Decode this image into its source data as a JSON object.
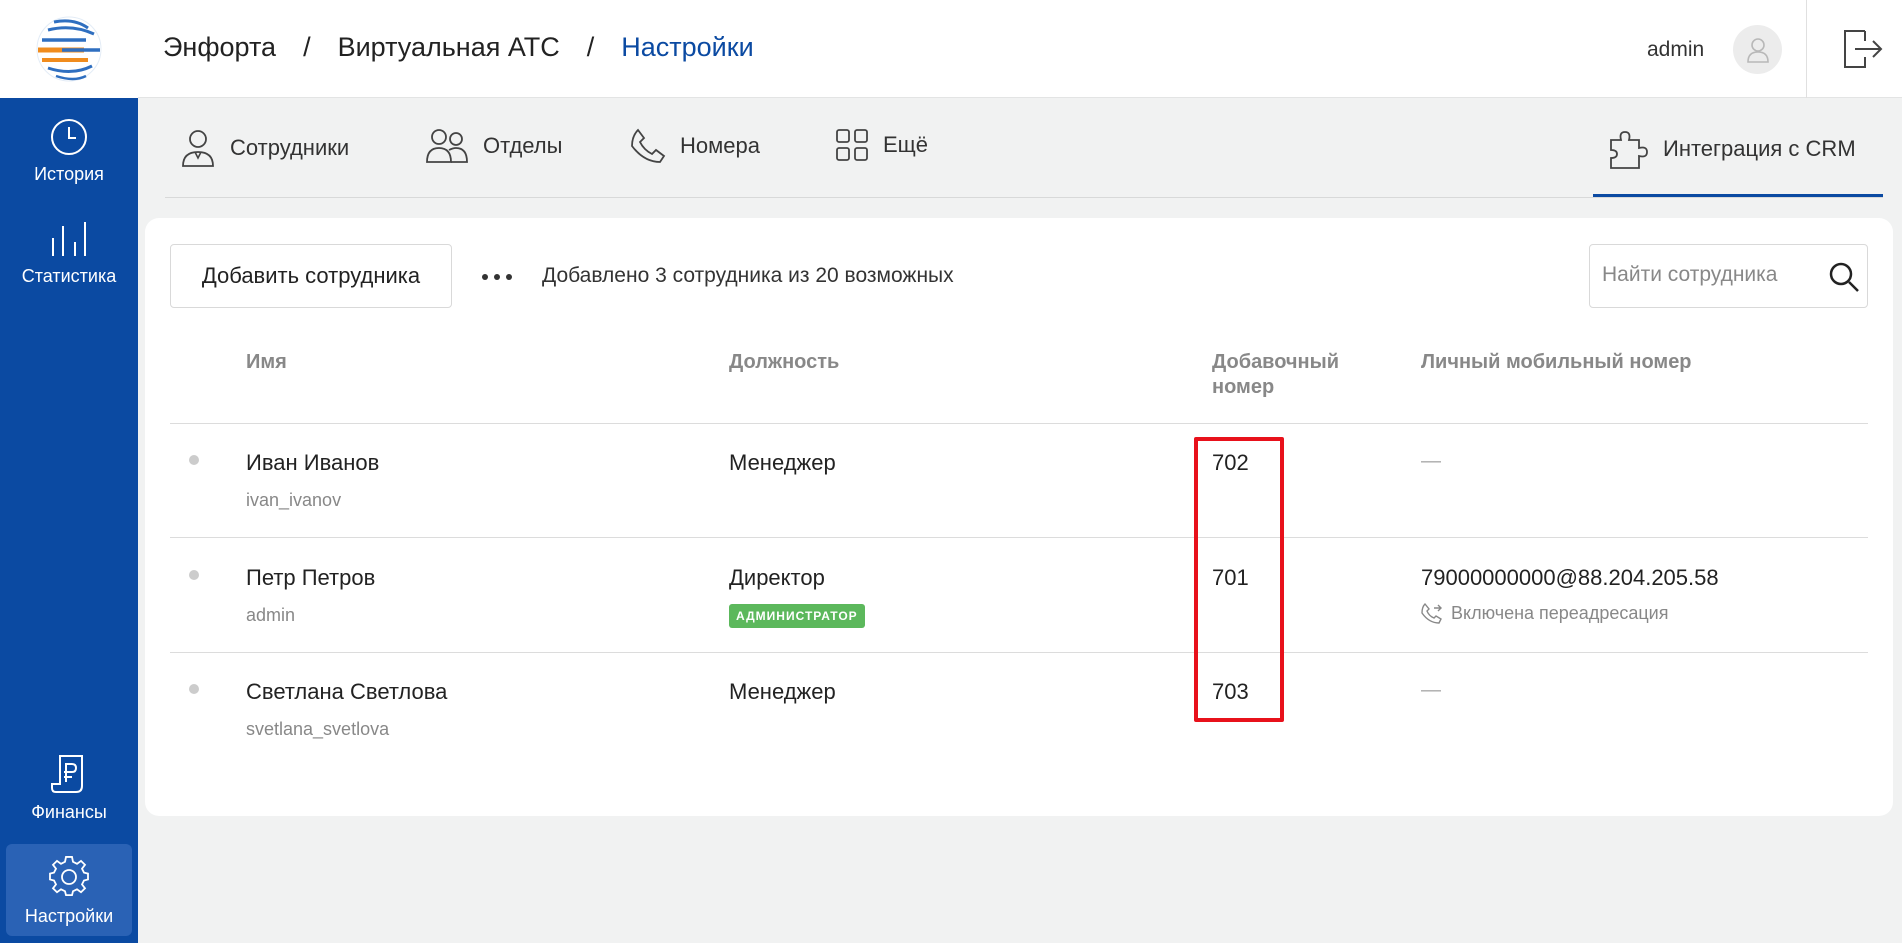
{
  "sidebar": {
    "items": [
      {
        "label": "История",
        "icon": "clock-icon"
      },
      {
        "label": "Статистика",
        "icon": "bar-chart-icon"
      },
      {
        "label": "Финансы",
        "icon": "ruble-document-icon"
      },
      {
        "label": "Настройки",
        "icon": "gear-icon"
      }
    ],
    "active": "Настройки"
  },
  "header": {
    "breadcrumbs": [
      "Энфорта",
      "Виртуальная АТС",
      "Настройки"
    ],
    "separator": "/",
    "user": "admin"
  },
  "tabs": [
    {
      "label": "Сотрудники",
      "icon": "user-icon"
    },
    {
      "label": "Отделы",
      "icon": "group-icon"
    },
    {
      "label": "Номера",
      "icon": "phone-icon"
    },
    {
      "label": "Ещё",
      "icon": "grid-icon"
    },
    {
      "label": "Интеграция с CRM",
      "icon": "puzzle-icon"
    }
  ],
  "toolbar": {
    "add_label": "Добавить сотрудника",
    "added_text": "Добавлено 3 сотрудника из 20 возможных",
    "search_placeholder": "Найти сотрудника"
  },
  "table": {
    "headers": {
      "name": "Имя",
      "position": "Должность",
      "extension_1": "Добавочный",
      "extension_2": "номер",
      "mobile": "Личный мобильный номер"
    },
    "rows": [
      {
        "name": "Иван Иванов",
        "login": "ivan_ivanov",
        "position": "Менеджер",
        "extension": "702",
        "mobile": "—"
      },
      {
        "name": "Петр Петров",
        "login": "admin",
        "position": "Директор",
        "badge": "АДМИНИСТРАТОР",
        "extension": "701",
        "mobile": "79000000000@88.204.205.58",
        "forwarding": "Включена переадресация"
      },
      {
        "name": "Светлана Светлова",
        "login": "svetlana_svetlova",
        "position": "Менеджер",
        "extension": "703",
        "mobile": "—"
      }
    ]
  },
  "colors": {
    "brand_blue": "#0b4aa2",
    "badge_green": "#5cb85c",
    "highlight_red": "#e8111b"
  }
}
